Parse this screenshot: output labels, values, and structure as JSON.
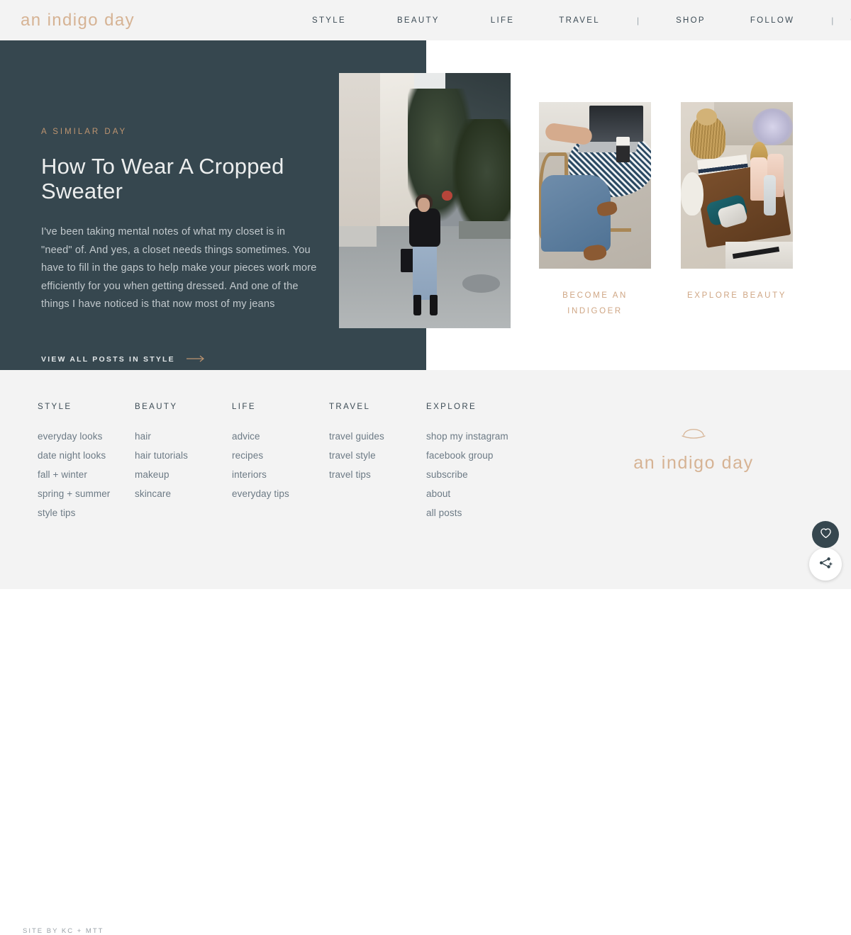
{
  "header": {
    "logo": "an indigo day",
    "nav": [
      {
        "label": "STYLE",
        "type": "link"
      },
      {
        "label": "BEAUTY",
        "type": "link"
      },
      {
        "label": "LIFE",
        "type": "link"
      },
      {
        "label": "TRAVEL",
        "type": "link"
      },
      {
        "label": "|",
        "type": "separator"
      },
      {
        "label": "SHOP",
        "type": "link"
      },
      {
        "label": "FOLLOW",
        "type": "link"
      },
      {
        "label": "|",
        "type": "separator"
      }
    ],
    "search_icon": "search-icon"
  },
  "hero": {
    "eyebrow": "A SIMILAR DAY",
    "title": "How To Wear A Cropped Sweater",
    "body": "I've been taking mental notes of what my closet is in \"need\" of. And yes, a closet needs things sometimes. You have to fill in the gaps to help make your pieces work more efficiently for you when getting dressed. And one of the things I have noticed is that now most of my jeans",
    "cta_label": "VIEW ALL POSTS IN STYLE",
    "cta_icon": "arrow-right-icon",
    "image_alt": "woman in black top and cropped jeans standing on a city street"
  },
  "cards": [
    {
      "label": "BECOME AN INDIGOER",
      "image_alt": "woman typing on a laptop at a blue bistro table with a coffee cup"
    },
    {
      "label": "EXPLORE BEAUTY",
      "image_alt": "beauty products on a wooden tray with a woven basket and flowers"
    }
  ],
  "footer": {
    "columns": [
      {
        "heading": "STYLE",
        "links": [
          "everyday looks",
          "date night looks",
          "fall + winter",
          "spring + summer",
          "style tips"
        ]
      },
      {
        "heading": "BEAUTY",
        "links": [
          "hair",
          "hair tutorials",
          "makeup",
          "skincare"
        ]
      },
      {
        "heading": "LIFE",
        "links": [
          "advice",
          "recipes",
          "interiors",
          "everyday tips"
        ]
      },
      {
        "heading": "TRAVEL",
        "links": [
          "travel guides",
          "travel style",
          "travel tips"
        ]
      },
      {
        "heading": "EXPLORE",
        "links": [
          "shop my instagram",
          "facebook group",
          "subscribe",
          "about",
          "all posts"
        ]
      }
    ],
    "brand_name": "an indigo day",
    "brand_mark": "arc-logo-icon",
    "credit": "SITE BY KC + MTT"
  },
  "floating": {
    "heart_icon": "heart-icon",
    "share_icon": "share-plus-icon"
  },
  "colors": {
    "dark_panel": "#36474f",
    "accent_tan": "#bd9470",
    "logo_tan": "#d6b394",
    "footer_bg": "#f3f3f3",
    "header_bg": "#f3f3f3",
    "link_grey": "#6c7a85"
  }
}
